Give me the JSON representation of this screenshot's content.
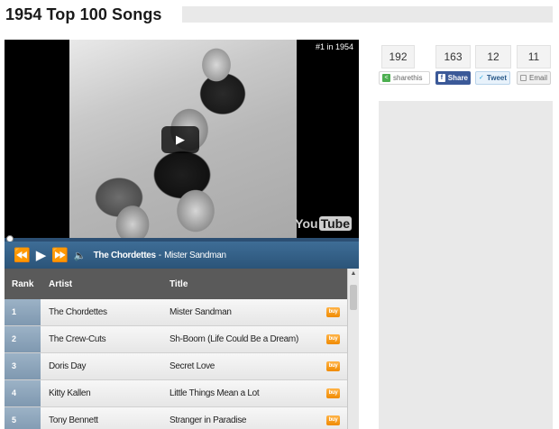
{
  "page": {
    "title": "1954 Top 100 Songs"
  },
  "player": {
    "rank_label": "#1 in 1954",
    "logo_you": "You",
    "logo_tube": "Tube",
    "now_playing_artist": "The Chordettes",
    "now_playing_separator": "-",
    "now_playing_title": "Mister Sandman",
    "progress_fraction": 0.0
  },
  "controls": {
    "rewind_icon": "rewind-icon",
    "play_icon": "play-icon",
    "forward_icon": "fast-forward-icon",
    "volume_icon": "volume-icon"
  },
  "table": {
    "headers": {
      "rank": "Rank",
      "artist": "Artist",
      "title": "Title"
    },
    "buy_label": "buy",
    "rows": [
      {
        "rank": "1",
        "artist": "The Chordettes",
        "title": "Mister Sandman"
      },
      {
        "rank": "2",
        "artist": "The Crew-Cuts",
        "title": "Sh-Boom (Life Could Be a Dream)"
      },
      {
        "rank": "3",
        "artist": "Doris Day",
        "title": "Secret Love"
      },
      {
        "rank": "4",
        "artist": "Kitty Kallen",
        "title": "Little Things Mean a Lot"
      },
      {
        "rank": "5",
        "artist": "Tony Bennett",
        "title": "Stranger in Paradise"
      }
    ]
  },
  "share": {
    "counts": [
      "192",
      "163",
      "12",
      "11"
    ],
    "sharethis": "sharethis",
    "facebook": "Share",
    "tweet": "Tweet",
    "email": "Email"
  },
  "colors": {
    "control_bar": "#33618a",
    "rank_cell": "#8ea5bb",
    "header": "#5a5a5a",
    "buy_button": "#f5a22b",
    "facebook": "#3b5998"
  }
}
